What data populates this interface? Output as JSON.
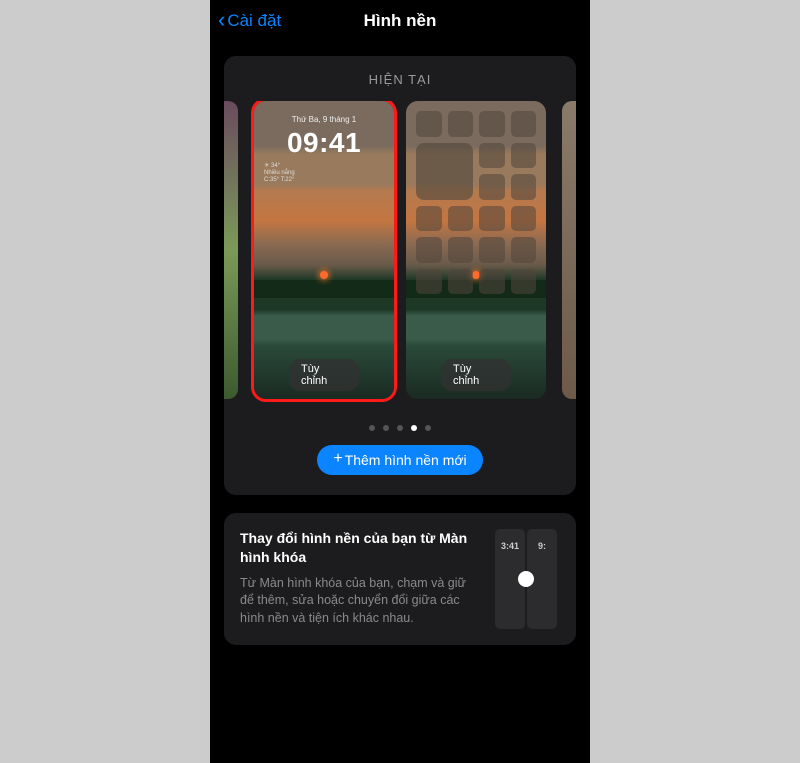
{
  "nav": {
    "back_label": "Cài đặt",
    "title": "Hình nền"
  },
  "current_section": {
    "header": "HIỆN TẠI",
    "lock_card": {
      "date_line": "Thứ Ba, 9 tháng 1",
      "time": "09:41",
      "widget_line1": "☀ 34°",
      "widget_line2": "Nhiều nắng",
      "widget_line3": "C:35° T:22°",
      "customize_label": "Tùy chỉnh"
    },
    "home_card": {
      "customize_label": "Tùy chỉnh"
    },
    "pagination": {
      "total": 5,
      "active_index": 3
    },
    "add_button_label": "Thêm hình nền mới"
  },
  "info_card": {
    "title": "Thay đổi hình nền của bạn từ Màn hình khóa",
    "description": "Từ Màn hình khóa của bạn, chạm và giữ để thêm, sửa hoặc chuyển đổi giữa các hình nền và tiện ích khác nhau.",
    "mini_time_left": "3:41",
    "mini_time_right": "9:"
  }
}
